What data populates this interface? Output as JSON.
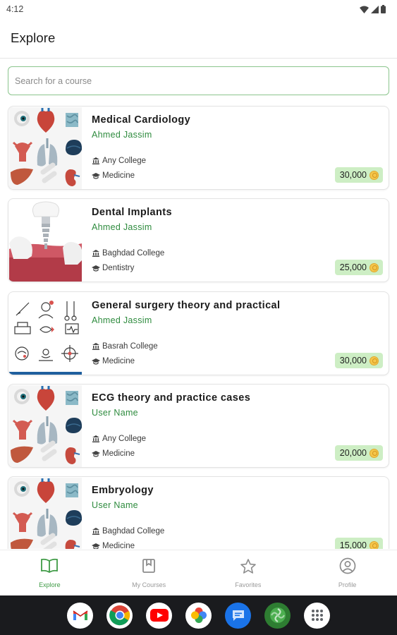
{
  "status_bar": {
    "time": "4:12"
  },
  "header": {
    "title": "Explore"
  },
  "search": {
    "placeholder": "Search for a course"
  },
  "courses": [
    {
      "title": "Medical Cardiology",
      "instructor": "Ahmed Jassim",
      "college": "Any College",
      "field": "Medicine",
      "price": "30,000",
      "thumbnail": "anatomy-organs-illustration"
    },
    {
      "title": "Dental Implants",
      "instructor": "Ahmed Jassim",
      "college": "Baghdad College",
      "field": "Dentistry",
      "price": "25,000",
      "thumbnail": "dental-implant-illustration"
    },
    {
      "title": "General surgery theory and practical",
      "instructor": "Ahmed Jassim",
      "college": "Basrah College",
      "field": "Medicine",
      "price": "30,000",
      "thumbnail": "surgery-line-icons"
    },
    {
      "title": "ECG theory and practice cases",
      "instructor": "User Name",
      "college": "Any College",
      "field": "Medicine",
      "price": "20,000",
      "thumbnail": "anatomy-organs-illustration"
    },
    {
      "title": "Embryology",
      "instructor": "User Name",
      "college": "Baghdad College",
      "field": "Medicine",
      "price": "15,000",
      "thumbnail": "anatomy-organs-illustration"
    }
  ],
  "bottom_nav": {
    "items": [
      {
        "label": "Explore",
        "icon": "open-book-icon",
        "active": true
      },
      {
        "label": "My Courses",
        "icon": "bookmark-book-icon",
        "active": false
      },
      {
        "label": "Favorites",
        "icon": "star-icon",
        "active": false
      },
      {
        "label": "Profile",
        "icon": "account-circle-icon",
        "active": false
      }
    ]
  },
  "dock": {
    "apps": [
      "gmail-icon",
      "chrome-icon",
      "youtube-icon",
      "google-photos-icon",
      "messages-icon",
      "camera-app-icon",
      "app-drawer-icon"
    ]
  },
  "colors": {
    "accent": "#3f9b46",
    "instructor_text": "#2e8b3e",
    "price_badge_bg": "#cdeec4",
    "search_border": "#8bc58d",
    "taskbar_bg": "#1a1b1e"
  }
}
